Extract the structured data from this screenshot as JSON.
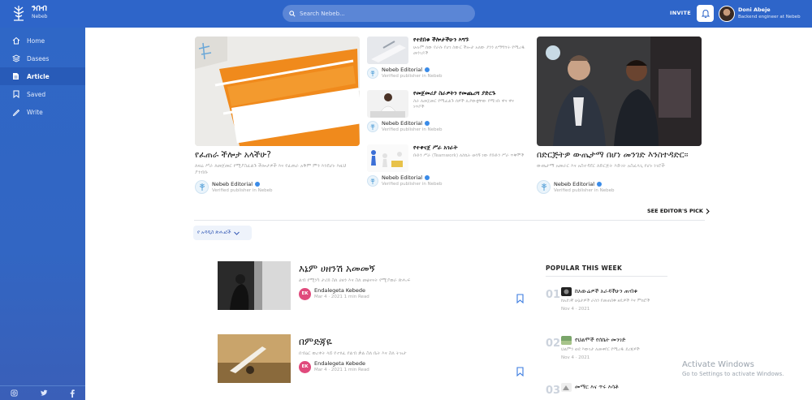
{
  "app": {
    "name": "ንበብ",
    "sub": "Nebeb"
  },
  "search": {
    "placeholder": "Search Nebeb..."
  },
  "header": {
    "invite": "INVITE"
  },
  "user": {
    "name": "Doni Abeje",
    "role": "Backend engineer at Nebeb"
  },
  "nav": [
    {
      "label": "Home",
      "icon": "home-icon"
    },
    {
      "label": "Dasees",
      "icon": "layers-icon"
    },
    {
      "label": "Article",
      "icon": "article-icon"
    },
    {
      "label": "Saved",
      "icon": "bookmark-icon"
    },
    {
      "label": "Write",
      "icon": "pen-icon"
    }
  ],
  "featured": {
    "left": {
      "title": "የፈጠራ ችሎታ አላችሁ?",
      "excerpt": "ለዛሬ ሥራ ለመጀመር የሚያስፈልጉ ችሎታዎች እና የፈጠራ አቅም ምን እንደሆኑ እዚህ ያንብቡ",
      "author": "Nebeb Editorial",
      "role": "Verified publisher in Nebeb"
    },
    "mid": [
      {
        "title": "የተደበቁ ችሎታችሁን እግኙ",
        "excerpt": "ሁሉም ሰው የራሱ የሆነ ስውር ችሎታ አለው ያንን ለማግኘት የሚረዱ መንገዶች",
        "author": "Nebeb Editorial",
        "role": "Verified publisher in Nebeb"
      },
      {
        "title": "የመጀመሪያ ስራዎትን የመጨረሻ ያድርጉ",
        "excerpt": "ስራ ለመጀመር የሚፈልጉ ሰዎች ሊያውቋቸው የሚገቡ ዋና ዋና ነጥቦች",
        "author": "Nebeb Editorial",
        "role": "Verified publisher in Nebeb"
      },
      {
        "title": "የተቀናጀ ሥራ አገራት",
        "excerpt": "ቡድን ሥራ (Teamwork) ለስኬት ወሳኝ ነው የቡድን ሥራ ጥቅሞች",
        "author": "Nebeb Editorial",
        "role": "Verified publisher in Nebeb"
      }
    ],
    "right": {
      "title": "በድርጅትዎ ውጤታማ በሆነ መንገድ እንስተዳድር፡፡",
      "excerpt": "ውጤታማ አመራር እና አስተዳደር ለድርጅት እድገት አስፈላጊ የሆኑ ነገሮች",
      "author": "Nebeb Editorial",
      "role": "Verified publisher in Nebeb"
    }
  },
  "see_editors_pick": "SEE EDITOR'S PICK",
  "dropdown": {
    "label": "የ አዳዲስ ጽሑፎች"
  },
  "posts": [
    {
      "title": "እኔም ሀዘንሽ አመመኝ",
      "excerpt": "ልብ የሚነካ ታሪክ ስለ ሀዘን እና ስለ መፅናናት የሚያወራ ጽሑፍ",
      "author": "Endalegeta Kebede",
      "initials": "EK",
      "meta": "Mar 4 · 2021 1 min Read"
    },
    {
      "title": "በምድጃዬ",
      "excerpt": "በብዕር ወረቀት ላይ የተፃፈ የልብ ቃል ስለ ቤት እና ስለ ትዝታ",
      "author": "Endalegeta Kebede",
      "initials": "EK",
      "meta": "Mar 4 · 2021 1 min Read"
    }
  ],
  "popular": {
    "heading": "POPULAR THIS WEEK",
    "items": [
      {
        "num": "01",
        "title": "ከአውሬዎች አራዳችሁን ጠብቁ",
        "excerpt": "ከአደገኛ ሁኔታዎች ራስን የመጠበቅ ዘዴዎች እና ምክሮች",
        "meta": "Nov 4 · 2021"
      },
      {
        "num": "02",
        "title": "የህልሞች የሰኬት መንገድ",
        "excerpt": "ህልምን ወደ እውነታ ለመቀየር የሚረዱ ደረጃዎች",
        "meta": "Nov 4 · 2021"
      },
      {
        "num": "03",
        "title": "መማር እና ጥሩ እሳቶ",
        "excerpt": "",
        "meta": ""
      }
    ]
  },
  "activate": {
    "title": "Activate Windows",
    "sub": "Go to Settings to activate Windows."
  }
}
